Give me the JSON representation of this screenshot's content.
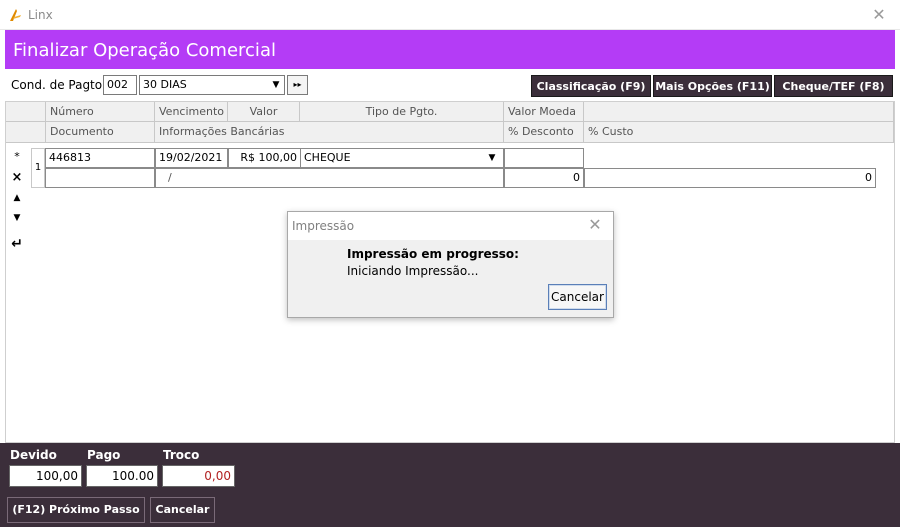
{
  "window": {
    "title": "Linx",
    "close_glyph": "✕"
  },
  "header": {
    "title": "Finalizar Operação Comercial"
  },
  "payment_condition": {
    "label": "Cond. de Pagto",
    "code": "002",
    "description": "30 DIAS",
    "dropdown_glyph": "▼",
    "next_glyph": "▸▸"
  },
  "toolbar": {
    "classificacao": "Classificação (F9)",
    "mais_opcoes": "Mais Opções (F11)",
    "cheque_tef": "Cheque/TEF (F8)"
  },
  "grid": {
    "header_row1": [
      "Número",
      "Vencimento",
      "Valor",
      "Tipo de Pgto.",
      "Valor Moeda"
    ],
    "header_row2": [
      "Documento",
      "Informações Bancárias",
      "% Desconto",
      "% Custo"
    ],
    "row_index": "1",
    "row": {
      "numero": "446813",
      "vencimento": "19/02/2021",
      "valor": "R$ 100,00",
      "tipo_pgto": "CHEQUE",
      "tipo_dropdown": "▼",
      "banco": "/",
      "desconto": "0",
      "custo": "0"
    },
    "side_icons": {
      "add": "*",
      "delete": "×",
      "up": "▲",
      "down": "▼",
      "enter": "↵"
    }
  },
  "footer": {
    "devido_label": "Devido",
    "devido_value": "100,00",
    "pago_label": "Pago",
    "pago_value": "100.00",
    "troco_label": "Troco",
    "troco_value": "0,00",
    "next_button": "(F12) Próximo Passo",
    "cancel_button": "Cancelar",
    "troco_color": "#b22222"
  },
  "dialog": {
    "title": "Impressão",
    "heading": "Impressão em progresso:",
    "message": "Iniciando Impressão...",
    "cancel_button": "Cancelar",
    "close_glyph": "✕"
  },
  "colors": {
    "header_bg": "#b43cf6",
    "dark_bg": "#3b2e3a",
    "logo_accent": "#e08a00"
  }
}
